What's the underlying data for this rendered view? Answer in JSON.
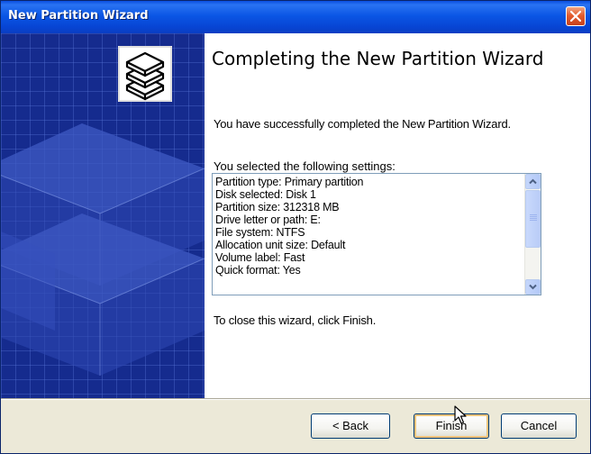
{
  "window": {
    "title": "New Partition Wizard"
  },
  "content": {
    "heading": "Completing the New Partition Wizard",
    "success_text": "You have successfully completed the New Partition Wizard.",
    "settings_label": "You selected the following settings:",
    "settings": [
      "Partition type: Primary partition",
      "Disk selected: Disk 1",
      "Partition size: 312318 MB",
      "Drive letter or path: E:",
      "File system: NTFS",
      "Allocation unit size: Default",
      "Volume label: Fast",
      "Quick format: Yes"
    ],
    "finish_text": "To close this wizard, click Finish."
  },
  "buttons": {
    "back": "< Back",
    "finish": "Finish",
    "cancel": "Cancel"
  },
  "colors": {
    "titlebar": "#0b56e5",
    "side_panel": "#152b8e",
    "close_button": "#e45d2f"
  },
  "icons": {
    "title_close": "close-icon",
    "wizard_graphic": "disk-stack-icon",
    "scroll_up": "scroll-up-arrow-icon",
    "scroll_down": "scroll-down-arrow-icon",
    "pointer": "mouse-cursor-icon"
  }
}
